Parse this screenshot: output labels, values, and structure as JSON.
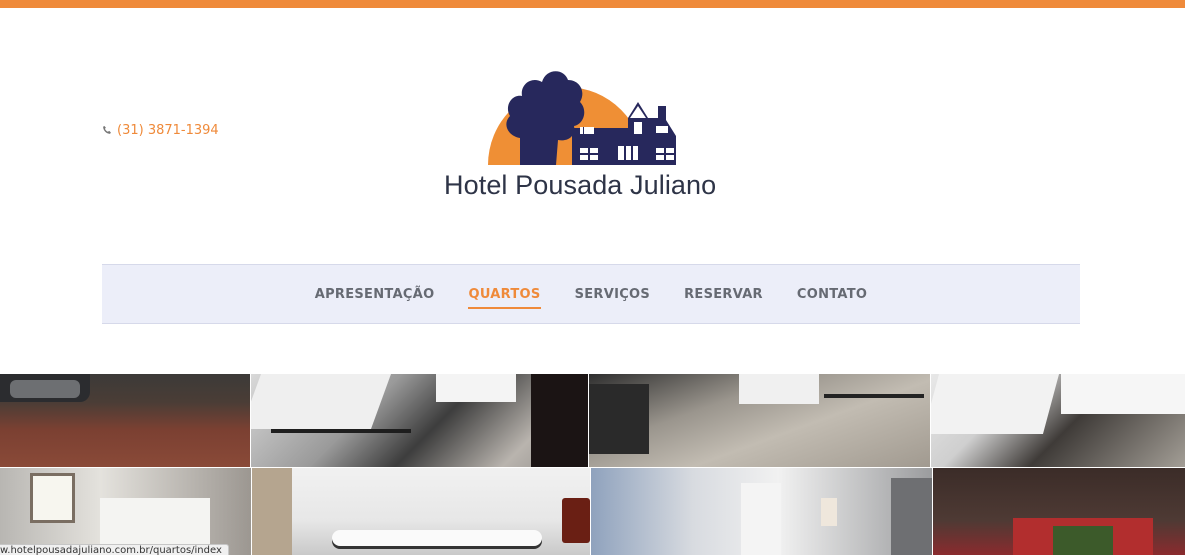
{
  "header": {
    "phone": "(31) 3871-1394",
    "logo_text": "Hotel Pousada Juliano"
  },
  "nav": {
    "items": [
      {
        "label": "APRESENTAÇÃO"
      },
      {
        "label": "QUARTOS",
        "active": true
      },
      {
        "label": "SERVIÇOS"
      },
      {
        "label": "RESERVAR"
      },
      {
        "label": "CONTATO"
      }
    ]
  },
  "colors": {
    "accent": "#ef8a3a",
    "nav_background": "#eceef9",
    "logo_navy": "#2b2a5e"
  },
  "status_bar": {
    "url": "w.hotelpousadajuliano.com.br/quartos/index"
  }
}
